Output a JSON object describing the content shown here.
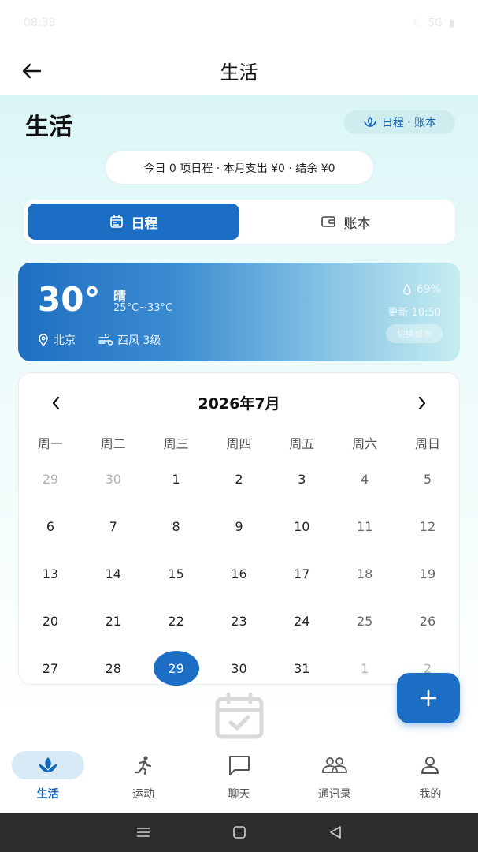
{
  "status": {
    "time": "08:38",
    "signal": "5G"
  },
  "header": {
    "title": "生活"
  },
  "page": {
    "heading": "生活"
  },
  "chip": {
    "label": "日程 · 账本"
  },
  "summary": {
    "text": "今日 0 项日程 · 本月支出 ¥0 · 结余 ¥0"
  },
  "tabs": [
    {
      "label": "日程",
      "icon": "calendar-icon",
      "active": true
    },
    {
      "label": "账本",
      "icon": "wallet-icon",
      "active": false
    }
  ],
  "weather": {
    "temp": "30°",
    "condition": "晴",
    "range": "25°C~33°C",
    "location": "北京",
    "wind": "西风 3级",
    "humidity": "69%",
    "updated": "更新 10:50",
    "switch_city": "切换城市"
  },
  "calendar": {
    "title": "2026年7月",
    "weekdays": [
      "周一",
      "周二",
      "周三",
      "周四",
      "周五",
      "周六",
      "周日"
    ],
    "weeks": [
      [
        "29",
        "30",
        "1",
        "2",
        "3",
        "4",
        "5"
      ],
      [
        "6",
        "7",
        "8",
        "9",
        "10",
        "11",
        "12"
      ],
      [
        "13",
        "14",
        "15",
        "16",
        "17",
        "18",
        "19"
      ],
      [
        "20",
        "21",
        "22",
        "23",
        "24",
        "25",
        "26"
      ],
      [
        "27",
        "28",
        "29",
        "30",
        "31",
        "1",
        "2"
      ]
    ],
    "selected": "29"
  },
  "nav": [
    {
      "label": "生活",
      "icon": "lotus-icon",
      "active": true
    },
    {
      "label": "运动",
      "icon": "running-icon",
      "active": false
    },
    {
      "label": "聊天",
      "icon": "chat-bubble-icon",
      "active": false
    },
    {
      "label": "通讯录",
      "icon": "contacts-icon",
      "active": false
    },
    {
      "label": "我的",
      "icon": "profile-icon",
      "active": false
    }
  ],
  "colors": {
    "accent": "#1b6ec4",
    "chip_bg": "#cfecef"
  }
}
